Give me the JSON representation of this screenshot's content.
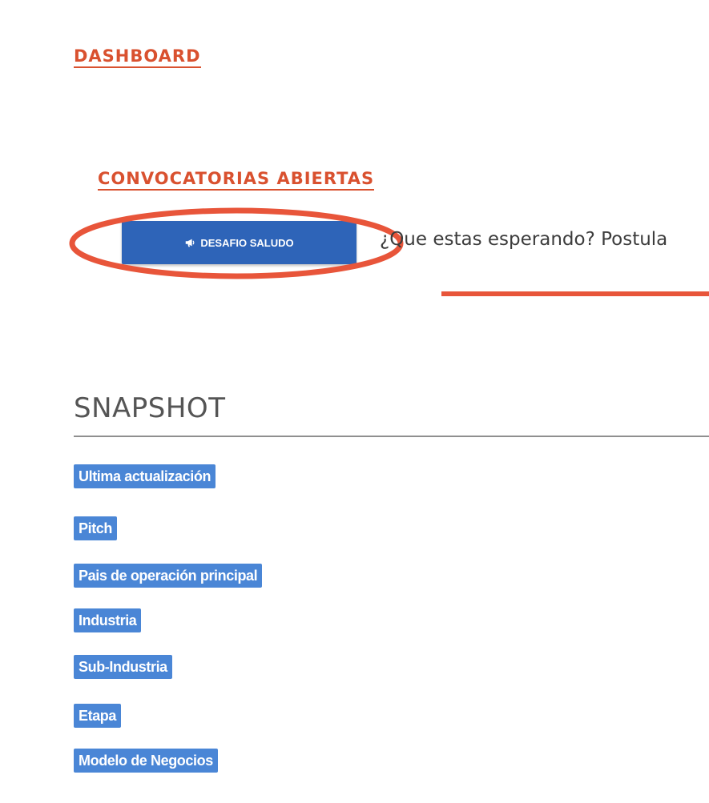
{
  "dashboard": {
    "title": "DASHBOARD"
  },
  "convocatorias": {
    "title": "CONVOCATORIAS ABIERTAS",
    "button_label": "DESAFIO SALUDO",
    "button_icon": "megaphone-icon",
    "prompt_text": "¿Que estas esperando? Postula"
  },
  "annotation": {
    "color": "#e8553a"
  },
  "snapshot": {
    "title": "SNAPSHOT",
    "labels": [
      "Ultima actualización",
      "Pitch",
      "Pais de operación principal",
      "Industria",
      "Sub-Industria",
      "Etapa",
      "Modelo de Negocios"
    ]
  },
  "colors": {
    "accent": "#d9512f",
    "button": "#2e64b8",
    "label": "#4a86d6"
  }
}
